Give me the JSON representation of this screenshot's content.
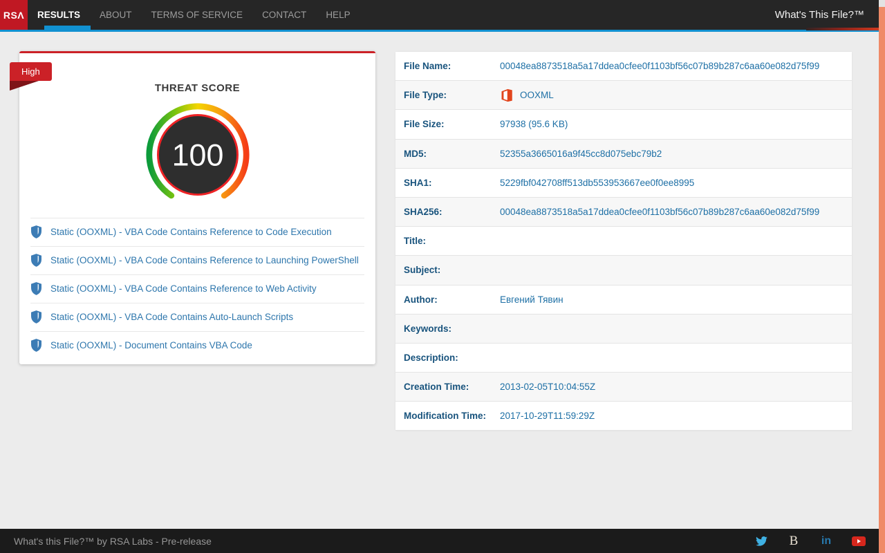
{
  "navbar": {
    "brand_display": "RSΛ",
    "items": [
      {
        "label": "RESULTS",
        "active": true
      },
      {
        "label": "ABOUT"
      },
      {
        "label": "TERMS OF SERVICE"
      },
      {
        "label": "CONTACT"
      },
      {
        "label": "HELP"
      }
    ],
    "right_title": "What's This File?™"
  },
  "threat_card": {
    "badge": "High",
    "title": "THREAT SCORE",
    "score": "100",
    "score_max": 100,
    "severity_color": "#cb2127",
    "findings": [
      "Static (OOXML) - VBA Code Contains Reference to Code Execution",
      "Static (OOXML) - VBA Code Contains Reference to Launching PowerShell",
      "Static (OOXML) - VBA Code Contains Reference to Web Activity",
      "Static (OOXML) - VBA Code Contains Auto-Launch Scripts",
      "Static (OOXML) - Document Contains VBA Code"
    ]
  },
  "details_table": {
    "rows": [
      {
        "label": "File Name:",
        "value": "00048ea8873518a5a17ddea0cfee0f1103bf56c07b89b287c6aa60e082d75f99"
      },
      {
        "label": "File Type:",
        "value": "OOXML",
        "icon": "office-icon"
      },
      {
        "label": "File Size:",
        "value": "97938 (95.6 KB)"
      },
      {
        "label": "MD5:",
        "value": "52355a3665016a9f45cc8d075ebc79b2"
      },
      {
        "label": "SHA1:",
        "value": "5229fbf042708ff513db553953667ee0f0ee8995"
      },
      {
        "label": "SHA256:",
        "value": "00048ea8873518a5a17ddea0cfee0f1103bf56c07b89b287c6aa60e082d75f99"
      },
      {
        "label": "Title:",
        "value": ""
      },
      {
        "label": "Subject:",
        "value": ""
      },
      {
        "label": "Author:",
        "value": "Евгений Тявин"
      },
      {
        "label": "Keywords:",
        "value": ""
      },
      {
        "label": "Description:",
        "value": ""
      },
      {
        "label": "Creation Time:",
        "value": "2013-02-05T10:04:55Z"
      },
      {
        "label": "Modification Time:",
        "value": "2017-10-29T11:59:29Z"
      }
    ]
  },
  "footer": {
    "text": "What's this File?™ by RSA Labs - Pre-release",
    "social_icons": [
      "twitter-icon",
      "b-icon",
      "linkedin-icon",
      "youtube-icon"
    ]
  },
  "colors": {
    "navbar_bg": "#262626",
    "rsa_red": "#c01823",
    "accent_blue": "#1191d1",
    "threat_red": "#cb2127",
    "link_blue": "#2d76ac",
    "label_blue": "#18537d",
    "value_blue": "#1d6fa5",
    "scrollbar_salmon": "#ef8a67",
    "page_bg": "#ececec"
  }
}
